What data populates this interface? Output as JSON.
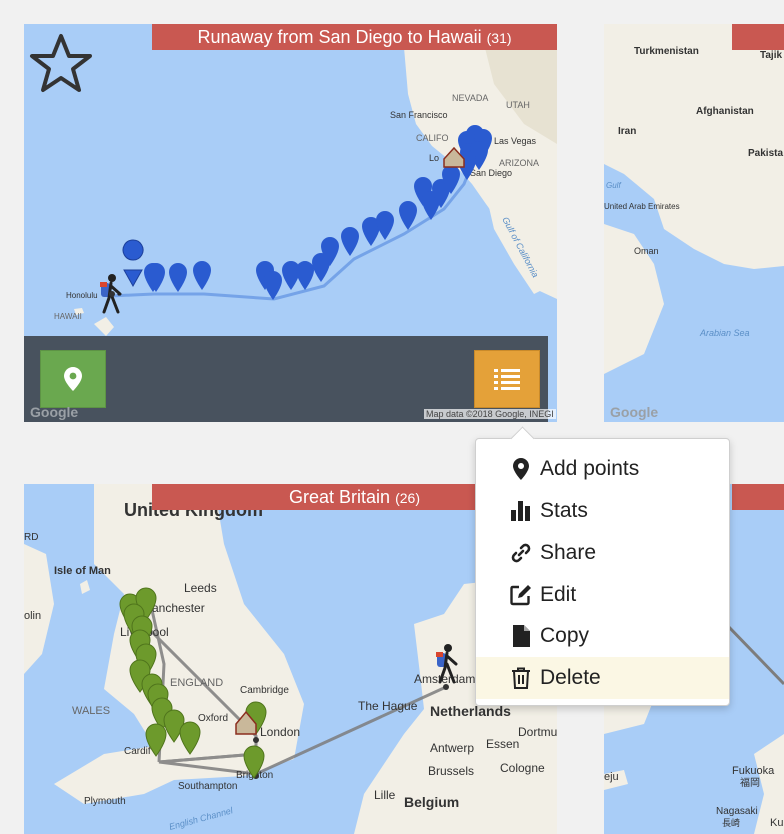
{
  "cards": [
    {
      "title": "Runaway from San Diego to Hawaii",
      "count": "(31)",
      "attribution": "Map data ©2018 Google, INEGI",
      "google": "Google",
      "labels": {
        "nevada": "NEVADA",
        "utah": "UTAH",
        "san_francisco": "San Francisco",
        "califo": "CALIFO",
        "las_vegas": "Las Vegas",
        "los": "Lo",
        "arizona": "ARIZONA",
        "san_diego": "San Diego",
        "gulf": "Gulf of California",
        "honolulu": "Honolulu",
        "hawaii": "HAWAII"
      }
    },
    {
      "google": "Google",
      "labels": {
        "turkmenistan": "Turkmenistan",
        "tajik": "Tajik",
        "afghanistan": "Afghanistan",
        "iran": "Iran",
        "pakistan": "Pakista",
        "gulf": "Gulf",
        "uae": "United Arab Emirates",
        "oman": "Oman",
        "arabian_sea": "Arabian Sea"
      }
    },
    {
      "title": "Great Britain",
      "count": "(26)",
      "labels": {
        "uk": "United Kingdom",
        "isle_of_man": "Isle of Man",
        "leeds": "Leeds",
        "manchester": "anchester",
        "liverpool": "Liverpool",
        "england": "ENGLAND",
        "wales": "WALES",
        "cambridge": "Cambridge",
        "oxford": "Oxford",
        "london": "London",
        "cardiff": "Cardif",
        "southampton": "Southampton",
        "brighton": "Brighton",
        "plymouth": "Plymouth",
        "english_channel": "English Channel",
        "amsterdam": "Amsterdam",
        "the_hague": "The Hague",
        "netherlands": "Netherlands",
        "dortmund": "Dortmu",
        "essen": "Essen",
        "antwerp": "Antwerp",
        "cologne": "Cologne",
        "brussels": "Brussels",
        "lille": "Lille",
        "belgium": "Belgium",
        "rd": "RD",
        "dublin": "olin"
      }
    },
    {
      "labels": {
        "fukuoka": "Fukuoka",
        "fukuoka_jp": "福岡",
        "nagasaki": "Nagasaki",
        "nagasaki_jp": "長崎",
        "jeju": "eju",
        "ku": "Ku"
      }
    }
  ],
  "menu": {
    "items": [
      {
        "label": "Add points",
        "icon": "map-marker-icon"
      },
      {
        "label": "Stats",
        "icon": "bar-chart-icon"
      },
      {
        "label": "Share",
        "icon": "link-icon"
      },
      {
        "label": "Edit",
        "icon": "edit-icon"
      },
      {
        "label": "Copy",
        "icon": "file-icon"
      },
      {
        "label": "Delete",
        "icon": "trash-icon"
      }
    ],
    "highlighted": "Delete"
  },
  "colors": {
    "title_bar": "#c95851",
    "water": "#a9cdf7",
    "land": "#f2efe6",
    "route_pins": "#2a5bd0",
    "gb_pins": "#6d9a2c",
    "action_green": "#6aa84f",
    "action_orange": "#e4a139",
    "bottom_bar": "#48525e",
    "menu_highlight": "#fbf7e4"
  }
}
